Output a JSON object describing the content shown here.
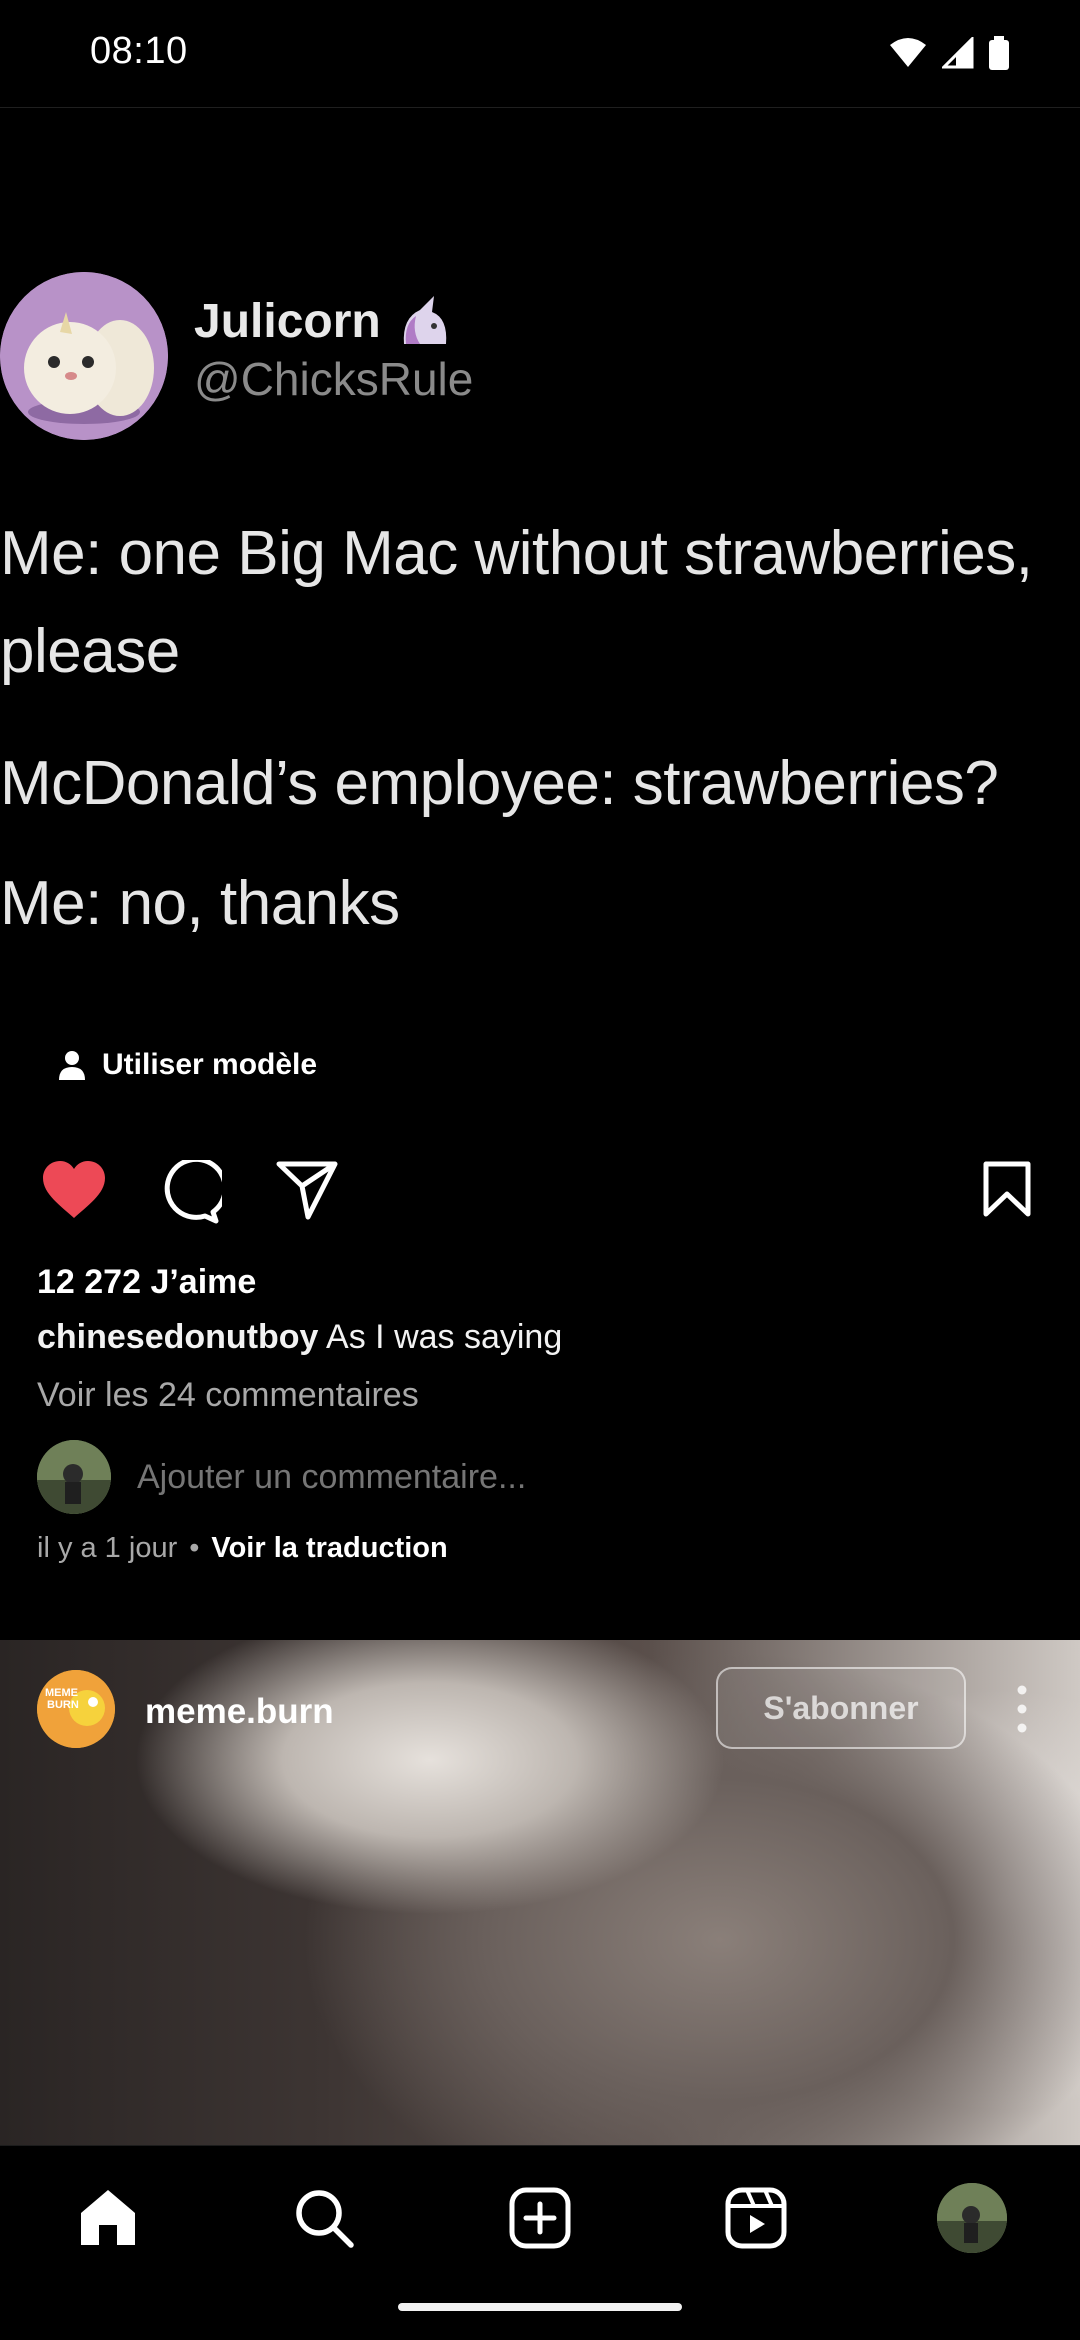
{
  "status_bar": {
    "time": "08:10"
  },
  "post": {
    "tweet": {
      "display_name": "Julicorn",
      "handle": "@ChicksRule",
      "lines": [
        "Me: one Big Mac without strawberries,",
        "please",
        "McDonald’s employee: strawberries?",
        "Me: no, thanks"
      ]
    },
    "template_label": "Utiliser modèle",
    "likes": "12 272 J’aime",
    "caption_user": "chinesedonutboy",
    "caption_text": "As I was saying",
    "view_comments": "Voir les 24 commentaires",
    "comment_placeholder": "Ajouter un commentaire...",
    "time_ago": "il y a 1 jour",
    "translate_label": "Voir la traduction"
  },
  "next_post": {
    "username": "meme.burn",
    "follow_label": "S'abonner",
    "avatar_text": "MEME BURN"
  },
  "colors": {
    "like_red": "#ed4956",
    "background": "#000000",
    "muted": "#a8a8a8"
  },
  "icons": {
    "actions": [
      "heart-icon",
      "comment-icon",
      "share-icon",
      "bookmark-icon"
    ],
    "nav": [
      "home-icon",
      "search-icon",
      "create-icon",
      "reels-icon",
      "profile-avatar"
    ]
  }
}
